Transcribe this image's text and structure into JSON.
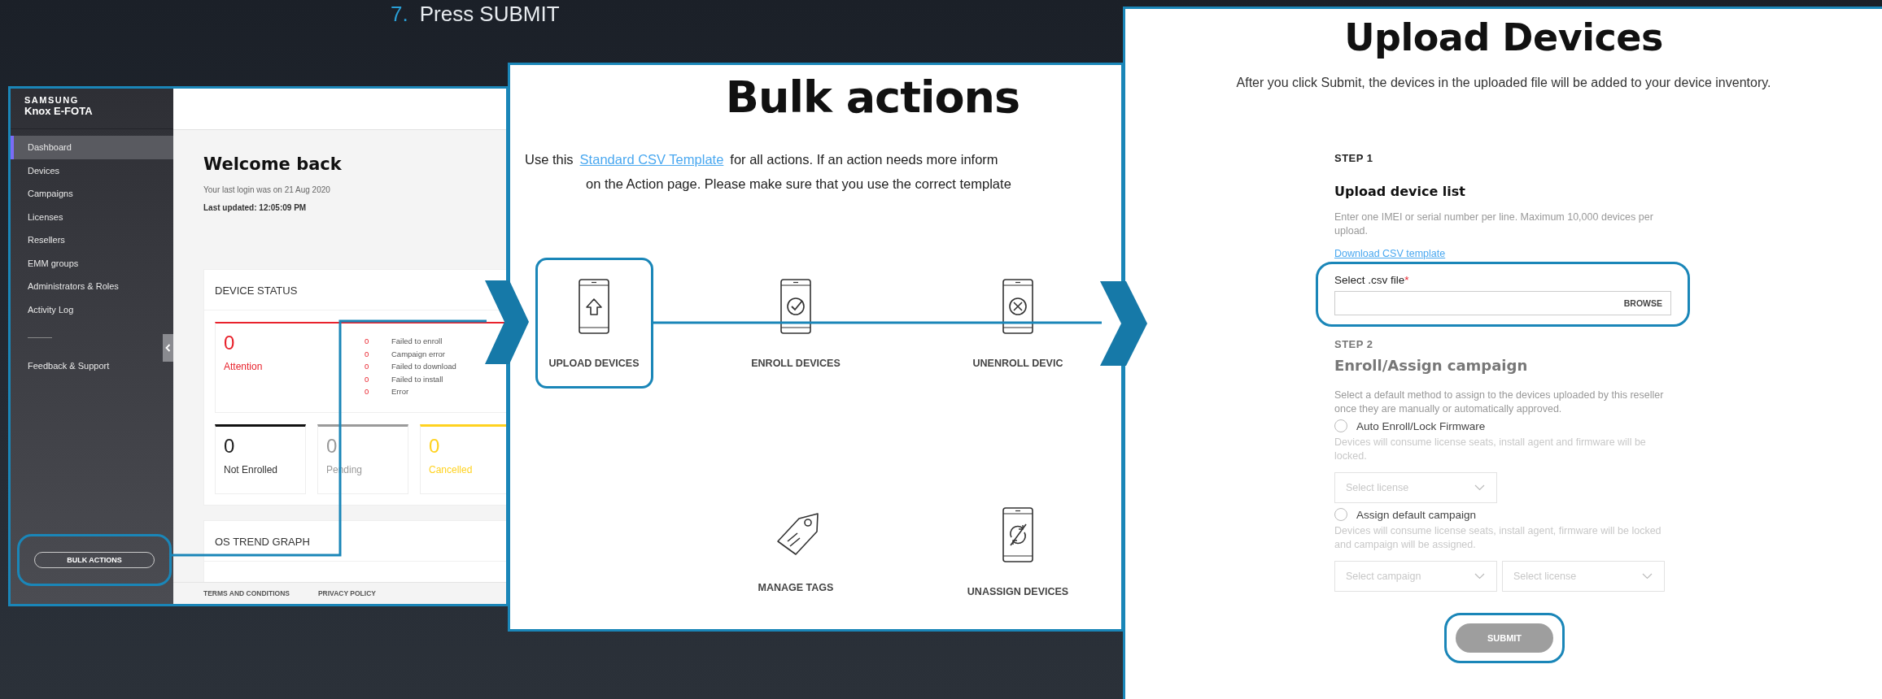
{
  "slide": {
    "step_number": "7.",
    "step_text": "Press SUBMIT"
  },
  "dashboard": {
    "brand": "SAMSUNG",
    "product": "Knox E-FOTA",
    "nav": [
      {
        "label": "Dashboard",
        "selected": true
      },
      {
        "label": "Devices",
        "selected": false
      },
      {
        "label": "Campaigns",
        "selected": false
      },
      {
        "label": "Licenses",
        "selected": false
      },
      {
        "label": "Resellers",
        "selected": false
      },
      {
        "label": "EMM groups",
        "selected": false
      },
      {
        "label": "Administrators & Roles",
        "selected": false
      },
      {
        "label": "Activity Log",
        "selected": false
      }
    ],
    "secondary_nav": [
      {
        "label": "Feedback & Support",
        "selected": false
      }
    ],
    "bulk_button": {
      "label": "BULK ACTIONS",
      "highlighted": true
    },
    "welcome": "Welcome back",
    "last_login": "Your last login was on 21 Aug 2020",
    "last_updated": "Last updated: 12:05:09 PM",
    "device_status": {
      "title": "DEVICE STATUS",
      "attention": {
        "count": "0",
        "label": "Attention",
        "color": "#e8222c"
      },
      "issues": [
        {
          "count": "0",
          "label": "Failed to enroll"
        },
        {
          "count": "0",
          "label": "Campaign error"
        },
        {
          "count": "0",
          "label": "Failed to download"
        },
        {
          "count": "0",
          "label": "Failed to install"
        },
        {
          "count": "0",
          "label": "Error"
        }
      ],
      "cards": [
        {
          "count": "0",
          "label": "Not Enrolled",
          "color": "#111111"
        },
        {
          "count": "0",
          "label": "Pending",
          "color": "#9a9a9a"
        },
        {
          "count": "0",
          "label": "Cancelled",
          "color": "#ffd21f"
        }
      ]
    },
    "os_trend": {
      "title": "OS TREND GRAPH"
    },
    "footer_links": [
      "TERMS AND CONDITIONS",
      "PRIVACY POLICY"
    ]
  },
  "bulk_actions": {
    "title": "Bulk actions",
    "intro_before": "Use this",
    "intro_link": "Standard CSV Template",
    "intro_after": "for all actions. If an action needs more inform",
    "intro_line2": "on the Action page. Please make sure that you use the correct template",
    "actions": [
      {
        "kind": "upload",
        "label": "UPLOAD DEVICES",
        "highlighted": true
      },
      {
        "kind": "enroll",
        "label": "ENROLL DEVICES",
        "highlighted": false
      },
      {
        "kind": "unenroll",
        "label": "UNENROLL DEVIC",
        "highlighted": false
      },
      {
        "kind": "tags",
        "label": "MANAGE TAGS",
        "highlighted": false
      },
      {
        "kind": "unassign",
        "label": "UNASSIGN DEVICES",
        "highlighted": false
      }
    ]
  },
  "upload": {
    "title": "Upload Devices",
    "subtitle": "After you click Submit, the devices in the uploaded file will be added to your device inventory.",
    "step1": {
      "step": "STEP 1",
      "heading": "Upload device list",
      "help": "Enter one IMEI or serial number per line. Maximum 10,000 devices per upload.",
      "link": "Download CSV template",
      "field_label": "Select .csv file",
      "required_mark": "*",
      "button": "BROWSE",
      "highlighted": true
    },
    "step2": {
      "step": "STEP 2",
      "heading": "Enroll/Assign campaign",
      "disabled": true,
      "help": "Select a default method to assign to the devices uploaded by this reseller once they are manually or automatically approved.",
      "options": [
        {
          "label": "Auto Enroll/Lock Firmware",
          "checked": false,
          "note": "Devices will consume license seats, install agent and firmware will be locked.",
          "selects": [
            "Select license"
          ]
        },
        {
          "label": "Assign default campaign",
          "checked": false,
          "note": "Devices will consume license seats, install agent, firmware will be locked and campaign will be assigned.",
          "selects": [
            "Select campaign",
            "Select license"
          ]
        }
      ]
    },
    "submit": {
      "label": "SUBMIT",
      "disabled": true,
      "highlighted": true
    }
  }
}
